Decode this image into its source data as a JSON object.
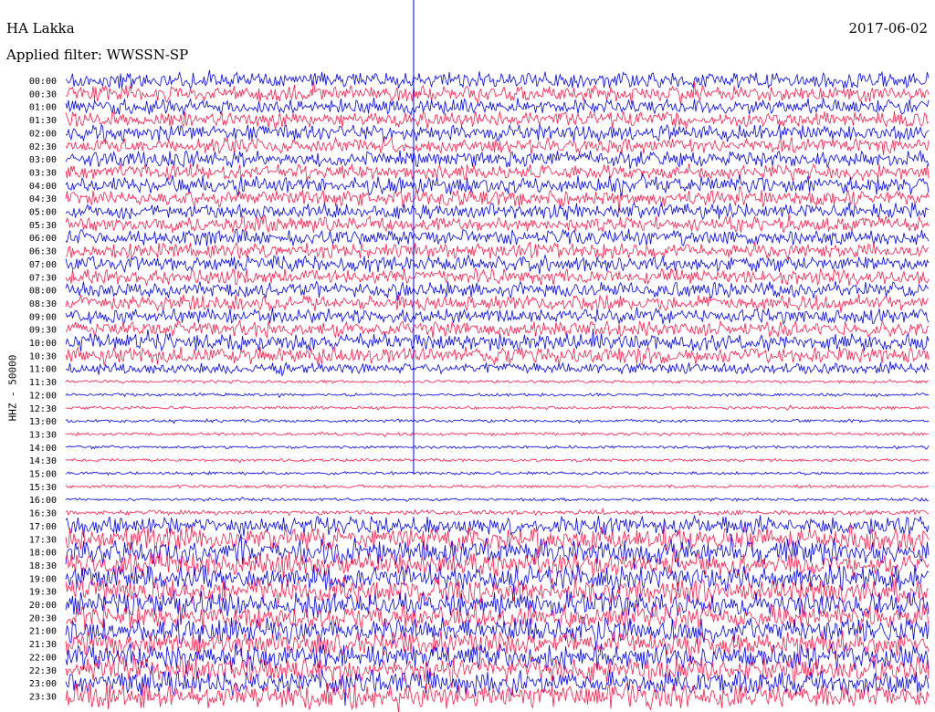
{
  "header": {
    "station": "HA Lakka",
    "filter": "Applied filter: WWSSN-SP",
    "date": "2017-06-02"
  },
  "chart_data": {
    "type": "helicorder",
    "ylabel": "HHZ - 50000",
    "colors": [
      "#0000ee",
      "#ff1a4a"
    ],
    "rows": [
      "00:00",
      "00:30",
      "01:00",
      "01:30",
      "02:00",
      "02:30",
      "03:00",
      "03:30",
      "04:00",
      "04:30",
      "05:00",
      "05:30",
      "06:00",
      "06:30",
      "07:00",
      "07:30",
      "08:00",
      "08:30",
      "09:00",
      "09:30",
      "10:00",
      "10:30",
      "11:00",
      "11:30",
      "12:00",
      "12:30",
      "13:00",
      "13:30",
      "14:00",
      "14:30",
      "15:00",
      "15:30",
      "16:00",
      "16:30",
      "17:00",
      "17:30",
      "18:00",
      "18:30",
      "19:00",
      "19:30",
      "20:00",
      "20:30",
      "21:00",
      "21:30",
      "22:00",
      "22:30",
      "23:00",
      "23:30"
    ],
    "amplitudes": [
      10,
      10,
      10,
      10,
      10,
      10,
      10,
      10,
      11,
      11,
      10,
      10,
      10,
      10,
      10,
      10,
      10,
      10,
      10,
      10,
      11,
      11,
      7,
      2,
      2,
      2,
      2,
      2,
      2,
      2,
      2,
      2,
      2,
      3,
      12,
      15,
      16,
      16,
      16,
      16,
      16,
      16,
      16,
      16,
      16,
      16,
      16,
      16
    ]
  }
}
